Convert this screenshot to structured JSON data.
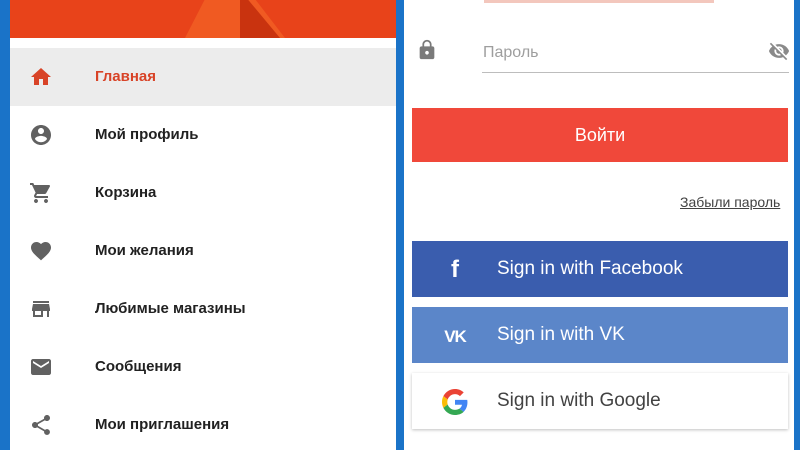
{
  "menu": {
    "items": [
      {
        "label": "Главная",
        "icon": "home-icon",
        "active": true
      },
      {
        "label": "Мой профиль",
        "icon": "account-circle-icon"
      },
      {
        "label": "Корзина",
        "icon": "cart-icon"
      },
      {
        "label": "Мои желания",
        "icon": "heart-icon"
      },
      {
        "label": "Любимые магазины",
        "icon": "store-icon"
      },
      {
        "label": "Сообщения",
        "icon": "mail-icon"
      },
      {
        "label": "Мои приглашения",
        "icon": "share-icon"
      }
    ]
  },
  "login": {
    "password_placeholder": "Пароль",
    "submit_label": "Войти",
    "forgot_label": "Забыли пароль"
  },
  "social": {
    "facebook_label": "Sign in with Facebook",
    "vk_label": "Sign in with VK",
    "google_label": "Sign in with Google"
  },
  "colors": {
    "accent": "#d84327",
    "header": "#e8431a",
    "login_button": "#f0483a",
    "facebook": "#3a5dae",
    "vk": "#5b86c9",
    "frame": "#1a73c8"
  }
}
